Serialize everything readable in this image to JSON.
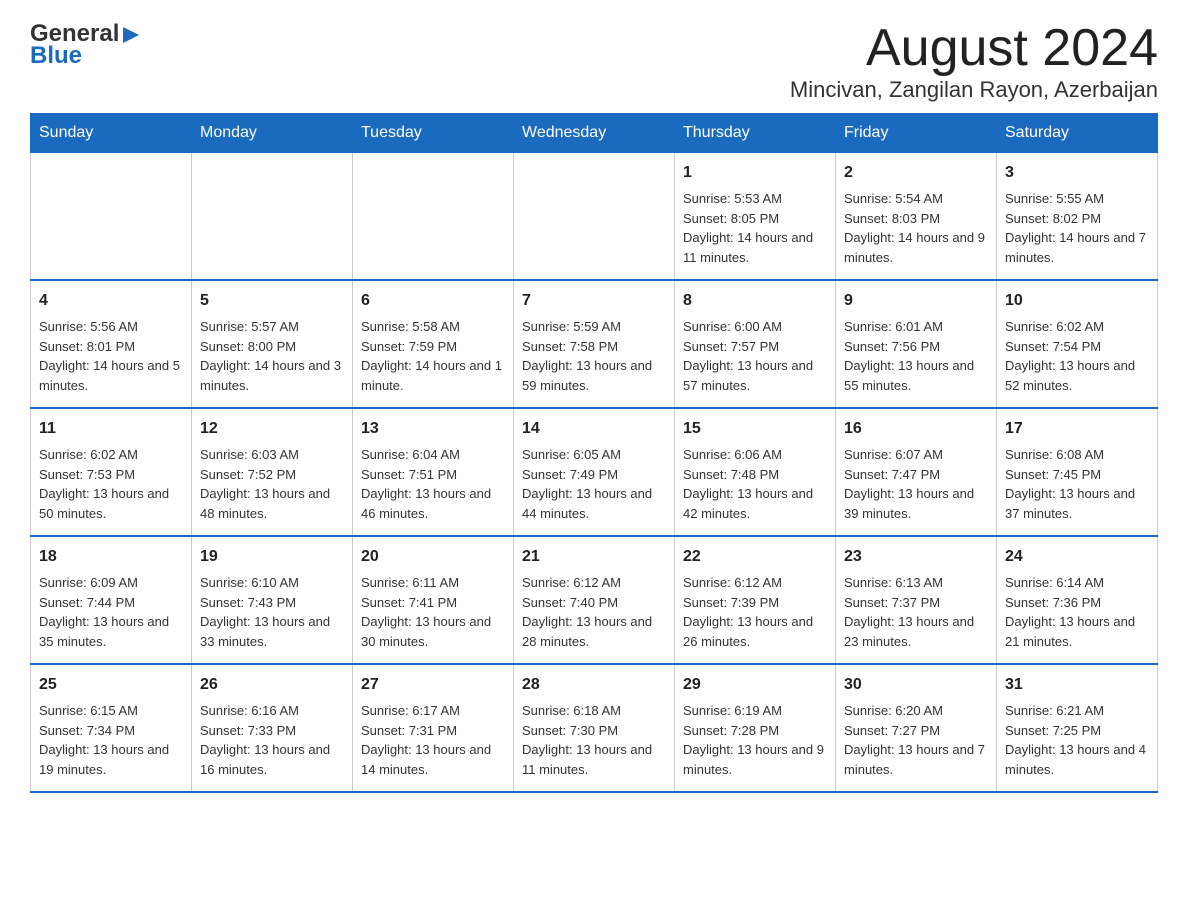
{
  "header": {
    "logo": {
      "general": "General",
      "blue": "Blue",
      "arrow_shape": "▶"
    },
    "title": "August 2024",
    "location": "Mincivan, Zangilan Rayon, Azerbaijan"
  },
  "calendar": {
    "days_of_week": [
      "Sunday",
      "Monday",
      "Tuesday",
      "Wednesday",
      "Thursday",
      "Friday",
      "Saturday"
    ],
    "weeks": [
      {
        "cells": [
          {
            "day": "",
            "info": ""
          },
          {
            "day": "",
            "info": ""
          },
          {
            "day": "",
            "info": ""
          },
          {
            "day": "",
            "info": ""
          },
          {
            "day": "1",
            "info": "Sunrise: 5:53 AM\nSunset: 8:05 PM\nDaylight: 14 hours and 11 minutes."
          },
          {
            "day": "2",
            "info": "Sunrise: 5:54 AM\nSunset: 8:03 PM\nDaylight: 14 hours and 9 minutes."
          },
          {
            "day": "3",
            "info": "Sunrise: 5:55 AM\nSunset: 8:02 PM\nDaylight: 14 hours and 7 minutes."
          }
        ]
      },
      {
        "cells": [
          {
            "day": "4",
            "info": "Sunrise: 5:56 AM\nSunset: 8:01 PM\nDaylight: 14 hours and 5 minutes."
          },
          {
            "day": "5",
            "info": "Sunrise: 5:57 AM\nSunset: 8:00 PM\nDaylight: 14 hours and 3 minutes."
          },
          {
            "day": "6",
            "info": "Sunrise: 5:58 AM\nSunset: 7:59 PM\nDaylight: 14 hours and 1 minute."
          },
          {
            "day": "7",
            "info": "Sunrise: 5:59 AM\nSunset: 7:58 PM\nDaylight: 13 hours and 59 minutes."
          },
          {
            "day": "8",
            "info": "Sunrise: 6:00 AM\nSunset: 7:57 PM\nDaylight: 13 hours and 57 minutes."
          },
          {
            "day": "9",
            "info": "Sunrise: 6:01 AM\nSunset: 7:56 PM\nDaylight: 13 hours and 55 minutes."
          },
          {
            "day": "10",
            "info": "Sunrise: 6:02 AM\nSunset: 7:54 PM\nDaylight: 13 hours and 52 minutes."
          }
        ]
      },
      {
        "cells": [
          {
            "day": "11",
            "info": "Sunrise: 6:02 AM\nSunset: 7:53 PM\nDaylight: 13 hours and 50 minutes."
          },
          {
            "day": "12",
            "info": "Sunrise: 6:03 AM\nSunset: 7:52 PM\nDaylight: 13 hours and 48 minutes."
          },
          {
            "day": "13",
            "info": "Sunrise: 6:04 AM\nSunset: 7:51 PM\nDaylight: 13 hours and 46 minutes."
          },
          {
            "day": "14",
            "info": "Sunrise: 6:05 AM\nSunset: 7:49 PM\nDaylight: 13 hours and 44 minutes."
          },
          {
            "day": "15",
            "info": "Sunrise: 6:06 AM\nSunset: 7:48 PM\nDaylight: 13 hours and 42 minutes."
          },
          {
            "day": "16",
            "info": "Sunrise: 6:07 AM\nSunset: 7:47 PM\nDaylight: 13 hours and 39 minutes."
          },
          {
            "day": "17",
            "info": "Sunrise: 6:08 AM\nSunset: 7:45 PM\nDaylight: 13 hours and 37 minutes."
          }
        ]
      },
      {
        "cells": [
          {
            "day": "18",
            "info": "Sunrise: 6:09 AM\nSunset: 7:44 PM\nDaylight: 13 hours and 35 minutes."
          },
          {
            "day": "19",
            "info": "Sunrise: 6:10 AM\nSunset: 7:43 PM\nDaylight: 13 hours and 33 minutes."
          },
          {
            "day": "20",
            "info": "Sunrise: 6:11 AM\nSunset: 7:41 PM\nDaylight: 13 hours and 30 minutes."
          },
          {
            "day": "21",
            "info": "Sunrise: 6:12 AM\nSunset: 7:40 PM\nDaylight: 13 hours and 28 minutes."
          },
          {
            "day": "22",
            "info": "Sunrise: 6:12 AM\nSunset: 7:39 PM\nDaylight: 13 hours and 26 minutes."
          },
          {
            "day": "23",
            "info": "Sunrise: 6:13 AM\nSunset: 7:37 PM\nDaylight: 13 hours and 23 minutes."
          },
          {
            "day": "24",
            "info": "Sunrise: 6:14 AM\nSunset: 7:36 PM\nDaylight: 13 hours and 21 minutes."
          }
        ]
      },
      {
        "cells": [
          {
            "day": "25",
            "info": "Sunrise: 6:15 AM\nSunset: 7:34 PM\nDaylight: 13 hours and 19 minutes."
          },
          {
            "day": "26",
            "info": "Sunrise: 6:16 AM\nSunset: 7:33 PM\nDaylight: 13 hours and 16 minutes."
          },
          {
            "day": "27",
            "info": "Sunrise: 6:17 AM\nSunset: 7:31 PM\nDaylight: 13 hours and 14 minutes."
          },
          {
            "day": "28",
            "info": "Sunrise: 6:18 AM\nSunset: 7:30 PM\nDaylight: 13 hours and 11 minutes."
          },
          {
            "day": "29",
            "info": "Sunrise: 6:19 AM\nSunset: 7:28 PM\nDaylight: 13 hours and 9 minutes."
          },
          {
            "day": "30",
            "info": "Sunrise: 6:20 AM\nSunset: 7:27 PM\nDaylight: 13 hours and 7 minutes."
          },
          {
            "day": "31",
            "info": "Sunrise: 6:21 AM\nSunset: 7:25 PM\nDaylight: 13 hours and 4 minutes."
          }
        ]
      }
    ]
  }
}
